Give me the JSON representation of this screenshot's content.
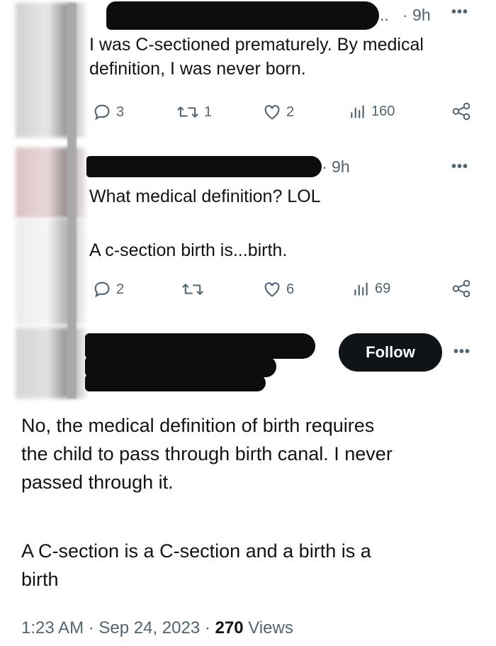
{
  "tweet1": {
    "handle_tail": "..",
    "time": "· 9h",
    "text_line1": "I was C-sectioned prematurely. By medical",
    "text_line2": "definition, I was never born.",
    "replies": "3",
    "reposts": "1",
    "likes": "2",
    "views": "160"
  },
  "tweet2": {
    "time": "· 9h",
    "text1": "What medical definition? LOL",
    "text2": "A c-section birth is...birth.",
    "replies": "2",
    "reposts": "",
    "likes": "6",
    "views": "69"
  },
  "tweet3": {
    "follow_label": "Follow",
    "para1_line1": "No, the medical definition of birth requires",
    "para1_line2": "the child to pass through birth canal. I never",
    "para1_line3": "passed through it.",
    "para2_line1": "A C-section is a C-section and a birth is a",
    "para2_line2": "birth",
    "timestamp": "1:23 AM · Sep 24, 2023 · ",
    "views_count": "270",
    "views_label": " Views"
  },
  "icons": [
    "reply-icon",
    "repost-icon",
    "like-icon",
    "views-icon",
    "share-icon",
    "more-icon"
  ],
  "colors": {
    "text": "#0f1419",
    "secondary": "#536471",
    "button": "#0f1419"
  }
}
